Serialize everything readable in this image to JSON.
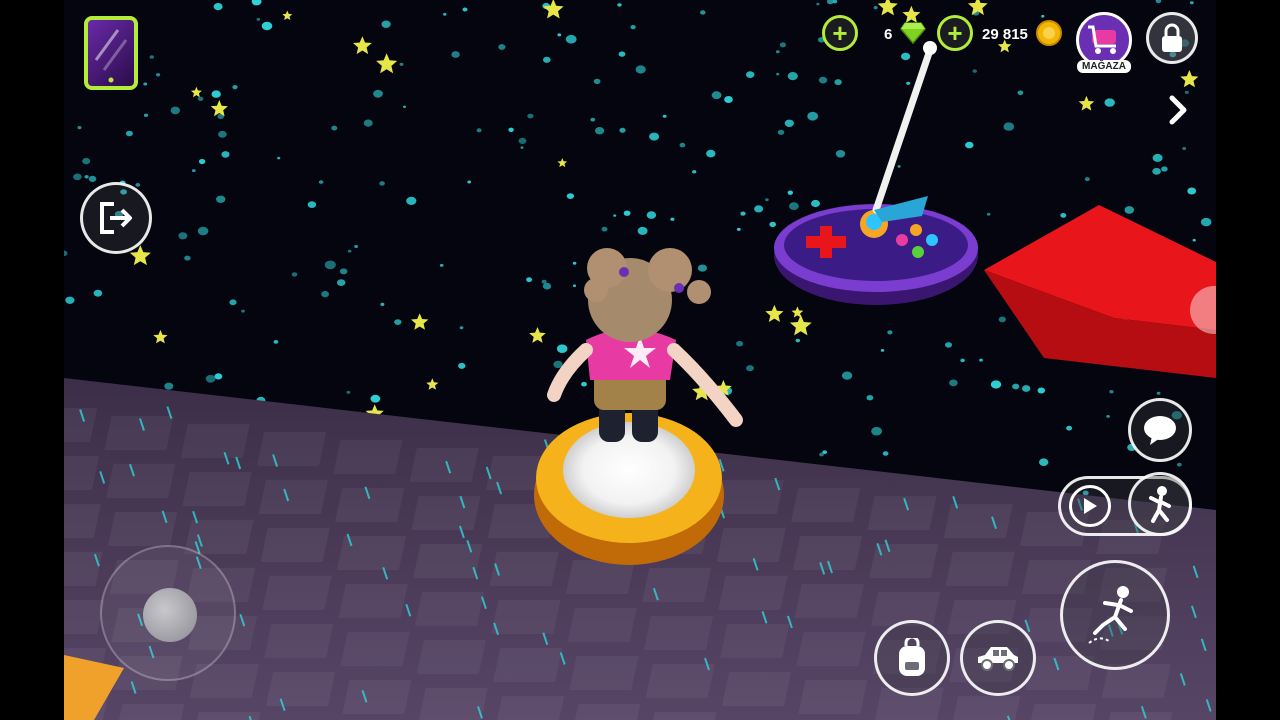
{
  "hud": {
    "gems": {
      "count": "6",
      "icon": "green-gem-icon",
      "color": "#7ed321"
    },
    "coins": {
      "count": "29 815",
      "icon": "gold-coin-icon",
      "color": "#f2b705"
    },
    "shop": {
      "label": "MAĞAZA",
      "icon": "shop-cart-icon"
    },
    "accent": "#b4ec3a"
  },
  "buttons": {
    "phone": "phone-icon",
    "exit": "exit-door-icon",
    "lock": "padlock-icon",
    "next": "chevron-right-icon",
    "chat": "chat-bubble-icon",
    "play": "play-icon",
    "emote": "dance-pose-icon",
    "jump": "jump-run-icon",
    "backpack": "backpack-icon",
    "vehicle": "car-icon",
    "joystick": "joystick-icon"
  },
  "scene": {
    "space_color": "#05050f",
    "floor_color": "#4a3a55",
    "platform_color": "#f0a012",
    "red_block_color": "#e8151b",
    "controller_disc_color": "#5b2ea8"
  }
}
